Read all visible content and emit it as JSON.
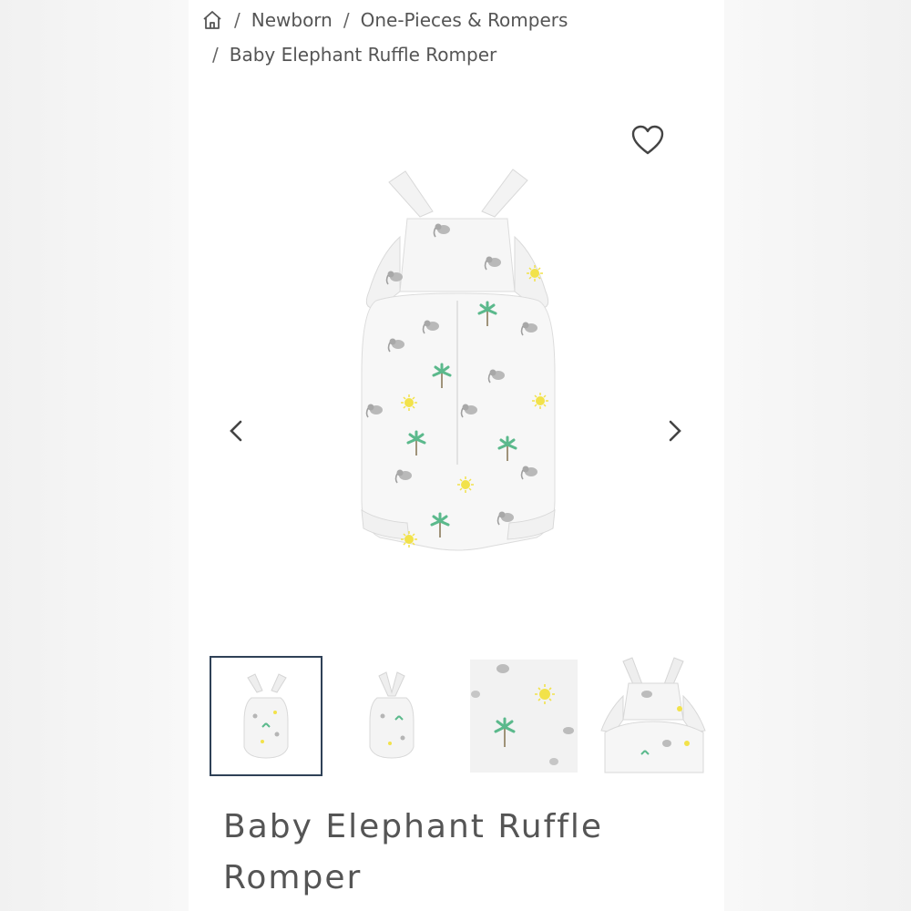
{
  "breadcrumb": {
    "home_icon": "home-icon",
    "items": [
      "Newborn",
      "One-Pieces & Rompers",
      "Baby Elephant Ruffle Romper"
    ],
    "separator": "/"
  },
  "gallery": {
    "favorite_icon": "heart-outline-icon",
    "prev_icon": "chevron-left-icon",
    "next_icon": "chevron-right-icon",
    "thumbnails_count": 4,
    "active_thumbnail": 1,
    "active_border_color": "#2f4157"
  },
  "product": {
    "title": "Baby Elephant Ruffle Romper"
  },
  "colors": {
    "text": "#555555",
    "palm_green": "#5bb98c",
    "sun_yellow": "#f2e24a",
    "elephant_grey": "#9a9a9a"
  }
}
